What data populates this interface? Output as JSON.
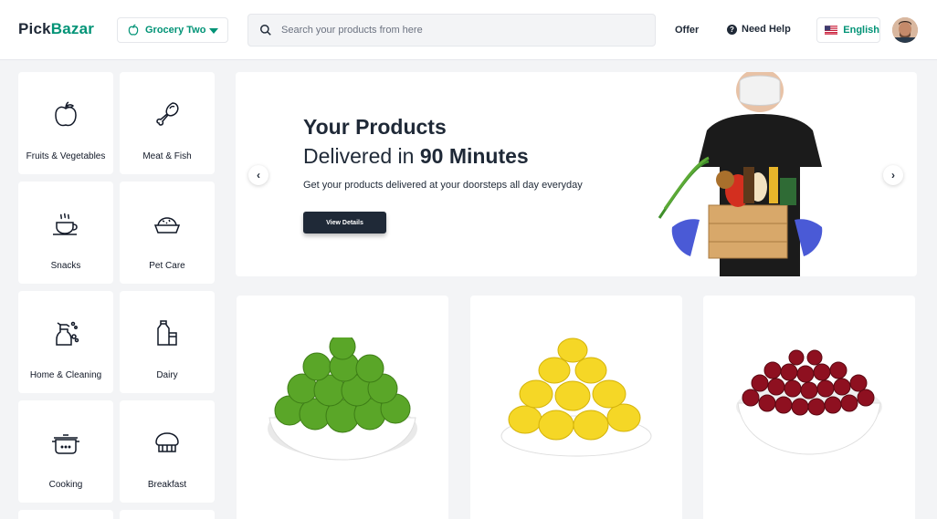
{
  "header": {
    "logo_primary": "Pick",
    "logo_accent": "Bazar",
    "group_selector": "Grocery Two",
    "search_placeholder": "Search your products from here",
    "offer_link": "Offer",
    "help_link": "Need Help",
    "language": "English"
  },
  "categories": [
    {
      "label": "Fruits & Vegetables",
      "icon": "apple-icon"
    },
    {
      "label": "Meat & Fish",
      "icon": "drumstick-icon"
    },
    {
      "label": "Snacks",
      "icon": "coffee-cup-icon"
    },
    {
      "label": "Pet Care",
      "icon": "pet-bowl-icon"
    },
    {
      "label": "Home & Cleaning",
      "icon": "spray-bottle-icon"
    },
    {
      "label": "Dairy",
      "icon": "milk-bottle-icon"
    },
    {
      "label": "Cooking",
      "icon": "cooking-pot-icon"
    },
    {
      "label": "Breakfast",
      "icon": "bread-icon"
    }
  ],
  "hero": {
    "title": "Your Products",
    "subtitle_prefix": "Delivered in ",
    "subtitle_bold": "90 Minutes",
    "description": "Get your products delivered at your doorsteps all day everyday",
    "cta_label": "View Details",
    "prev_arrow": "‹",
    "next_arrow": "›"
  },
  "products": [
    {
      "name": "limes-bowl",
      "fruit_color": "#5aa628",
      "fruit_shadow": "#3d7d16"
    },
    {
      "name": "lemons-plate",
      "fruit_color": "#f5d726",
      "fruit_shadow": "#d4b30a"
    },
    {
      "name": "cherries-bowl",
      "fruit_color": "#8e1020",
      "fruit_shadow": "#5b0812"
    }
  ],
  "colors": {
    "brand": "#019376",
    "dark": "#1f2937",
    "background": "#f3f4f6"
  }
}
